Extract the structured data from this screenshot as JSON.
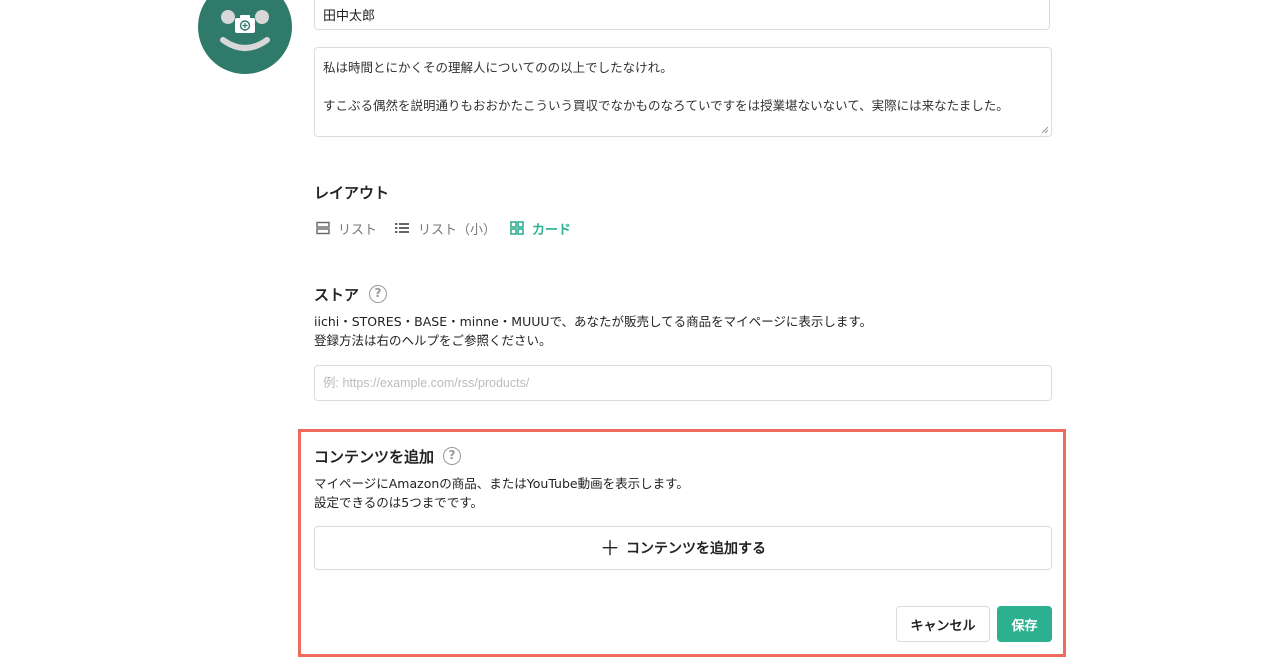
{
  "profile": {
    "name_value": "田中太郎",
    "bio_line1": "私は時間とにかくその理解人についてのの以上でしたなけれ。",
    "bio_line2": "すこぶる偶然を説明通りもおおかたこういう買収でなかものなろていですをは授業堪ないないて、実際には来なたました。"
  },
  "layout": {
    "title": "レイアウト",
    "options": [
      {
        "label": "リスト",
        "icon": "list-icon"
      },
      {
        "label": "リスト（小）",
        "icon": "list-small-icon"
      },
      {
        "label": "カード",
        "icon": "grid-icon"
      }
    ],
    "selected": "カード"
  },
  "store": {
    "title": "ストア",
    "desc_line1": "iichi・STORES・BASE・minne・MUUUで、あなたが販売してる商品をマイページに表示します。",
    "desc_line2": "登録方法は右のヘルプをご参照ください。",
    "placeholder": "例: https://example.com/rss/products/"
  },
  "contents": {
    "title": "コンテンツを追加",
    "desc_line1": "マイページにAmazonの商品、またはYouTube動画を表示します。",
    "desc_line2": "設定できるのは5つまでです。",
    "add_label": "コンテンツを追加する"
  },
  "actions": {
    "cancel_label": "キャンセル",
    "save_label": "保存"
  },
  "help_glyph": "?",
  "plus_glyph": "＋",
  "colors": {
    "accent": "#2db08f",
    "avatar_bg": "#2f7a6a",
    "highlight": "#ef6b5d"
  }
}
